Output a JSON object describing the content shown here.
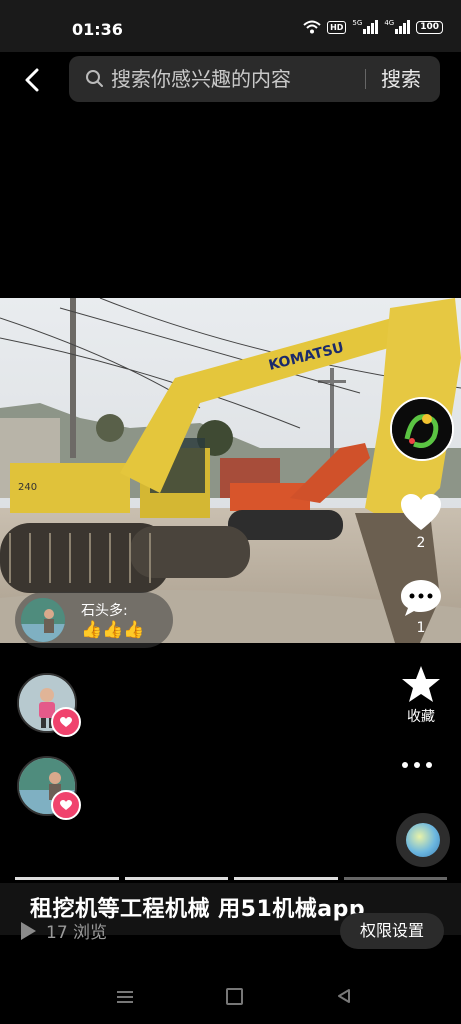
{
  "status_bar": {
    "time": "01:36",
    "hd_badge": "HD",
    "sig1_label": "5G",
    "sig2_label": "4G",
    "battery": "100"
  },
  "header": {
    "back_icon": "chevron-left-icon",
    "search_placeholder": "搜索你感兴趣的内容",
    "search_button": "搜索"
  },
  "comment": {
    "username": "石头多:",
    "text": "👍👍👍"
  },
  "actions": {
    "like_count": "2",
    "comment_count": "1",
    "collect_label": "收藏"
  },
  "caption": {
    "title": "租挖机等工程机械  用51机械app",
    "views": "17 浏览",
    "permission_button": "权限设置"
  },
  "photo": {
    "brand_text": "KOMATSU",
    "cab_text": "240"
  },
  "colors": {
    "accent_pink": "#f0436d",
    "excavator_yellow": "#e0c23a"
  }
}
